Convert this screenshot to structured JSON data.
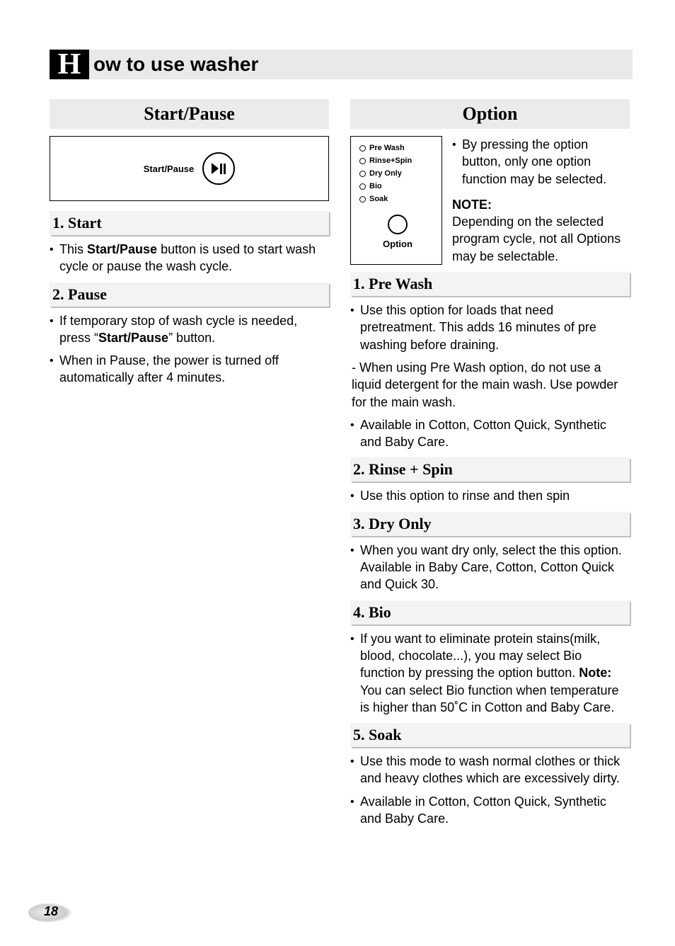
{
  "pageNumber": "18",
  "title": {
    "initial": "H",
    "rest": "ow to use washer"
  },
  "left": {
    "sectionTitle": "Start/Pause",
    "diagramLabel": "Start/Pause",
    "sub1": {
      "heading": "1. Start",
      "bullet1_pre": "This ",
      "bullet1_bold": "Start/Pause",
      "bullet1_post": " button is used  to start wash cycle or pause the wash cycle."
    },
    "sub2": {
      "heading": "2. Pause",
      "bullet1_pre": "If temporary stop of wash cycle is needed, press “",
      "bullet1_bold": "Start/Pause",
      "bullet1_post": "” button.",
      "bullet2": "When in Pause, the power is turned off automatically after 4 minutes."
    }
  },
  "right": {
    "sectionTitle": "Option",
    "diagram": {
      "options": [
        "Pre Wash",
        "Rinse+Spin",
        "Dry Only",
        "Bio",
        "Soak"
      ],
      "buttonLabel": "Option"
    },
    "sideBullet": "By pressing the option button, only one option function may be selected.",
    "noteLabel": "NOTE:",
    "noteText": "Depending on the selected program cycle, not all Options may be selectable.",
    "s1": {
      "heading": "1. Pre Wash",
      "b1": "Use this option for loads that need pretreatment. This adds 16 minutes of pre washing before draining.",
      "dash": "- When using Pre Wash option, do not use a liquid detergent for the main wash. Use powder for the main wash.",
      "b2": "Available in Cotton, Cotton Quick, Synthetic and Baby Care."
    },
    "s2": {
      "heading": "2. Rinse + Spin",
      "b1": "Use this option to rinse and then spin"
    },
    "s3": {
      "heading": "3. Dry Only",
      "b1": "When you want dry only, select the this option. Available in Baby Care, Cotton, Cotton Quick and Quick 30."
    },
    "s4": {
      "heading": "4. Bio",
      "b1_pre": "If you want to eliminate protein stains(milk, blood, chocolate...), you may select Bio function by pressing the option button. ",
      "b1_noteLabel": "Note:",
      "b1_post": " You can select Bio function when temperature is higher than 50˚C in Cotton and Baby Care."
    },
    "s5": {
      "heading": "5. Soak",
      "b1": "Use this mode to wash normal clothes or thick and heavy clothes which are excessively dirty.",
      "b2": "Available in Cotton, Cotton Quick, Synthetic and Baby Care."
    }
  }
}
